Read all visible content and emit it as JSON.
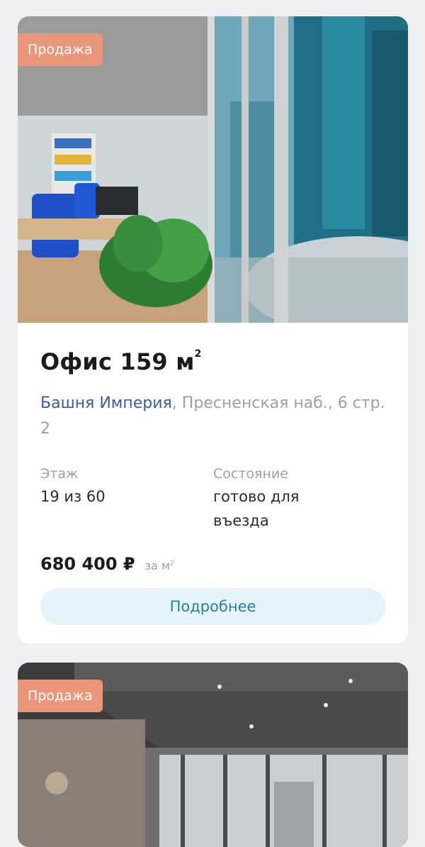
{
  "listings": [
    {
      "badge": "Продажа",
      "title": "Офис 159 м",
      "title_sup": "2",
      "tower": "Башня Империя",
      "address_rest": ", Пресненская наб., 6 стр. 2",
      "floor_label": "Этаж",
      "floor_value": "19 из 60",
      "state_label": "Состояние",
      "state_value": "готово для въезда",
      "price": "680 400 ₽",
      "per_unit": "за м",
      "per_unit_sup": "2",
      "button_label": "Подробнее"
    },
    {
      "badge": "Продажа"
    }
  ],
  "colors": {
    "badge_bg": "#e9967a",
    "tower_link": "#3d5ba0",
    "button_bg": "#e5f3fa",
    "button_text": "#2a7ea9"
  }
}
